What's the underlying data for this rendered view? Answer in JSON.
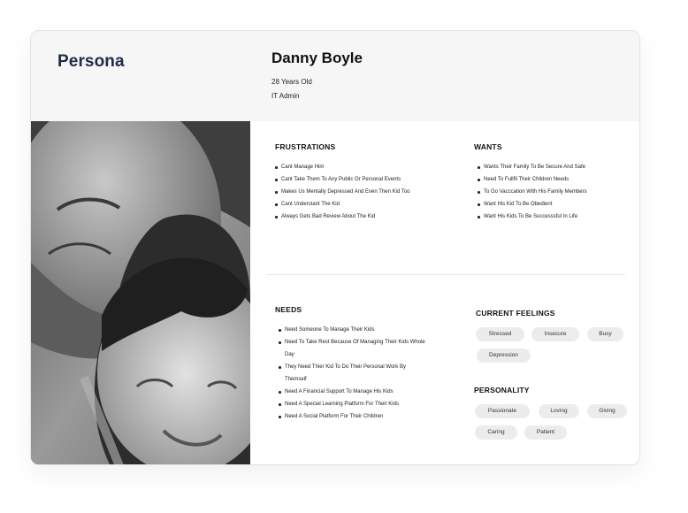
{
  "header": {
    "brand": "Persona",
    "name": "Danny Boyle",
    "age": "28  Years Old",
    "role": "IT Admin"
  },
  "photo": {
    "description_icon": "persona-photo"
  },
  "frustrations": {
    "title": "FRUSTRATIONS",
    "items": [
      "Cant Manage Him",
      "Cant Take Them To Any Public Or Personal Events",
      "Makes Us Mentally Depressed And Even Then Kid Too",
      "Cant Understant The Kid",
      "Always Gets Bad Review About The Kid"
    ]
  },
  "wants": {
    "title": "WANTS",
    "items": [
      "Wants Their Family To Be Secure And Safe",
      "Need To Fullfil Their Children Needs",
      "To Go Vacccation With His Family Members",
      "Want His Kid To Be Obedient",
      "Want His Kids To Be Successsful In Life"
    ]
  },
  "needs": {
    "title": "NEEDS",
    "items": [
      "Need Someone To Manage Their Kids",
      "Need To Take Rest Because Of Managing Their Kids Whole Day",
      "They Need Thier Kid To Do Their Personal Work By Themself",
      "Need A Financial Support To Manage His Kids",
      "Need A Special Learning Platform For Their Kids",
      "Need A Social Platform For Their Children"
    ]
  },
  "feelings": {
    "title": "CURRENT FEELINGS",
    "tags": [
      "Stressed",
      "Insecure",
      "Busy",
      "Depression"
    ]
  },
  "personality": {
    "title": "PERSONALITY",
    "tags": [
      "Passionate",
      "Loving",
      "Giving",
      "Caring",
      "Patient"
    ]
  },
  "colors": {
    "brand": "#222a48",
    "header_bg": "#f6f6f6",
    "tag_bg": "#ececec"
  }
}
